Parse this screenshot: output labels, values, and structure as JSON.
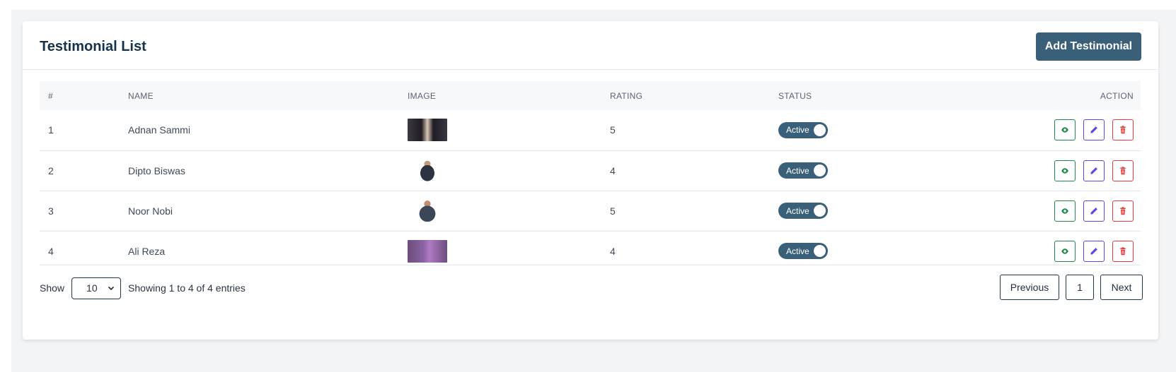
{
  "header": {
    "title": "Testimonial List",
    "add_button": "Add Testimonial"
  },
  "table": {
    "columns": [
      "#",
      "NAME",
      "IMAGE",
      "RATING",
      "STATUS",
      "ACTION"
    ],
    "rows": [
      {
        "index": "1",
        "name": "Adnan Sammi",
        "rating": "5",
        "status": "Active"
      },
      {
        "index": "2",
        "name": "Dipto Biswas",
        "rating": "4",
        "status": "Active"
      },
      {
        "index": "3",
        "name": "Noor Nobi",
        "rating": "5",
        "status": "Active"
      },
      {
        "index": "4",
        "name": "Ali Reza",
        "rating": "4",
        "status": "Active"
      }
    ]
  },
  "footer": {
    "show_label": "Show",
    "per_page": "10",
    "entries_info": "Showing 1 to 4 of 4 entries",
    "prev_label": "Previous",
    "current_page": "1",
    "next_label": "Next"
  },
  "colors": {
    "primary": "#3a6079",
    "view": "#1f8a4c",
    "edit": "#5b48e0",
    "delete": "#e03b3b"
  },
  "icons": {
    "view": "eye-icon",
    "edit": "pencil-icon",
    "delete": "trash-icon",
    "select": "chevron-down-icon"
  }
}
